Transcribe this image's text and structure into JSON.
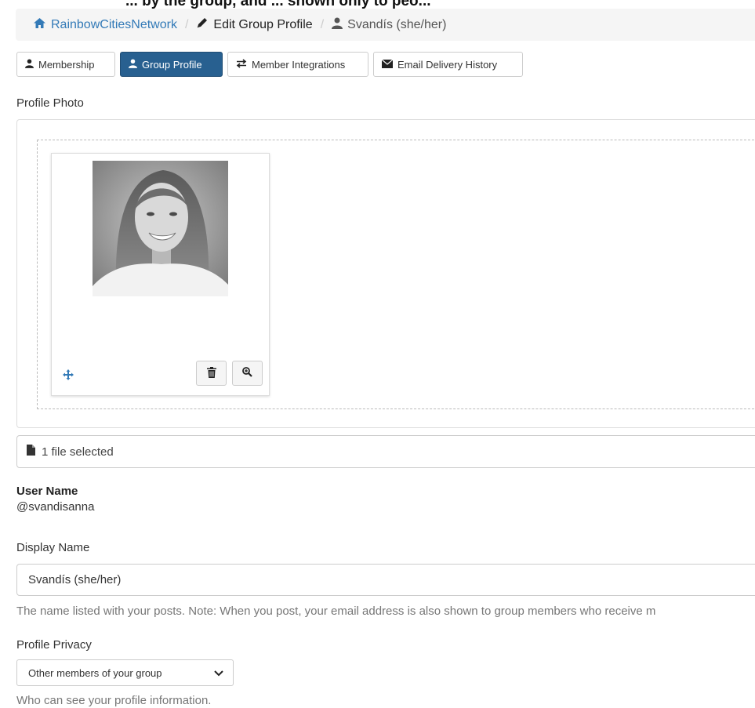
{
  "top_fragment": "... by the group, and ... shown only to peo...",
  "breadcrumb": {
    "home": "RainbowCitiesNetwork",
    "edit": "Edit Group Profile",
    "user": "Svandís (she/her)"
  },
  "tabs": {
    "membership": "Membership",
    "group_profile": "Group Profile",
    "member_integrations": "Member Integrations",
    "email_history": "Email Delivery History"
  },
  "profile_photo": {
    "label": "Profile Photo",
    "file_status": "1 file selected"
  },
  "user_name": {
    "heading": "User Name",
    "value": "@svandisanna"
  },
  "display_name": {
    "label": "Display Name",
    "value": "Svandís (she/her)",
    "help": "The name listed with your posts. Note: When you post, your email address is also shown to group members who receive m"
  },
  "profile_privacy": {
    "label": "Profile Privacy",
    "selected": "Other members of your group",
    "help": "Who can see your profile information."
  },
  "colors": {
    "accent": "#286090",
    "link": "#337ab7"
  }
}
